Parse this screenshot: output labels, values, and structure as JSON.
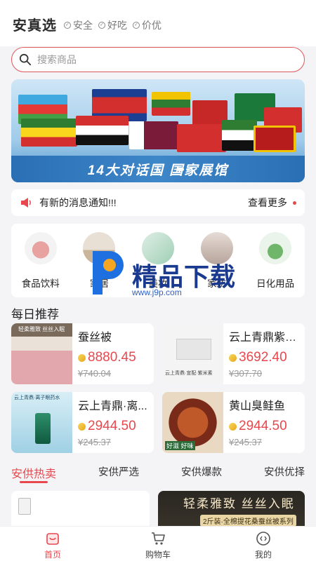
{
  "header": {
    "brand": "安真选",
    "tags": [
      "安全",
      "好吃",
      "价优"
    ]
  },
  "search": {
    "placeholder": "搜索商品"
  },
  "banner": {
    "caption": "14大对话国 国家展馆"
  },
  "notice": {
    "text": "有新的消息通知!!!",
    "more": "查看更多"
  },
  "categories": [
    {
      "label": "食品饮料",
      "icon": "meat-icon"
    },
    {
      "label": "家居",
      "icon": "furniture-icon"
    },
    {
      "label": "美妆",
      "icon": "cosmetics-icon"
    },
    {
      "label": "家纺",
      "icon": "textile-icon"
    },
    {
      "label": "日化用品",
      "icon": "detergent-icon"
    }
  ],
  "watermark": {
    "text": "精品下载",
    "url": "www.j9p.com"
  },
  "section": {
    "daily": "每日推荐"
  },
  "products": [
    {
      "name": "蚕丝被",
      "price": "8880.45",
      "old_price": "¥740.04",
      "img_text": "轻柔雅致 丝丝入眠"
    },
    {
      "name": "云上青鼎紫米...",
      "price": "3692.40",
      "old_price": "¥307.70",
      "img_text": "云上青鼎·宣配·紫米素"
    },
    {
      "name": "云上青鼎·离...",
      "price": "2944.50",
      "old_price": "¥245.37",
      "img_text": "云上青鼎·离子眼药水"
    },
    {
      "name": "黄山臭鲑鱼",
      "price": "2944.50",
      "old_price": "¥245.37",
      "img_text": "好滋 好味"
    }
  ],
  "tabs": [
    "安供热卖",
    "安供严选",
    "安供爆款",
    "安供优择"
  ],
  "feed": {
    "banner_title": "轻柔雅致 丝丝入眠",
    "banner_sub": "2斤装·全棉提花桑蚕丝被系列"
  },
  "tabbar": [
    {
      "label": "首页",
      "icon": "home-bag-icon",
      "active": true
    },
    {
      "label": "购物车",
      "icon": "cart-icon",
      "active": false
    },
    {
      "label": "我的",
      "icon": "profile-icon",
      "active": false
    }
  ],
  "colors": {
    "accent": "#e8474d",
    "brand_text": "#2b2b2b",
    "banner_caption_bg": "#2a6fb4"
  }
}
